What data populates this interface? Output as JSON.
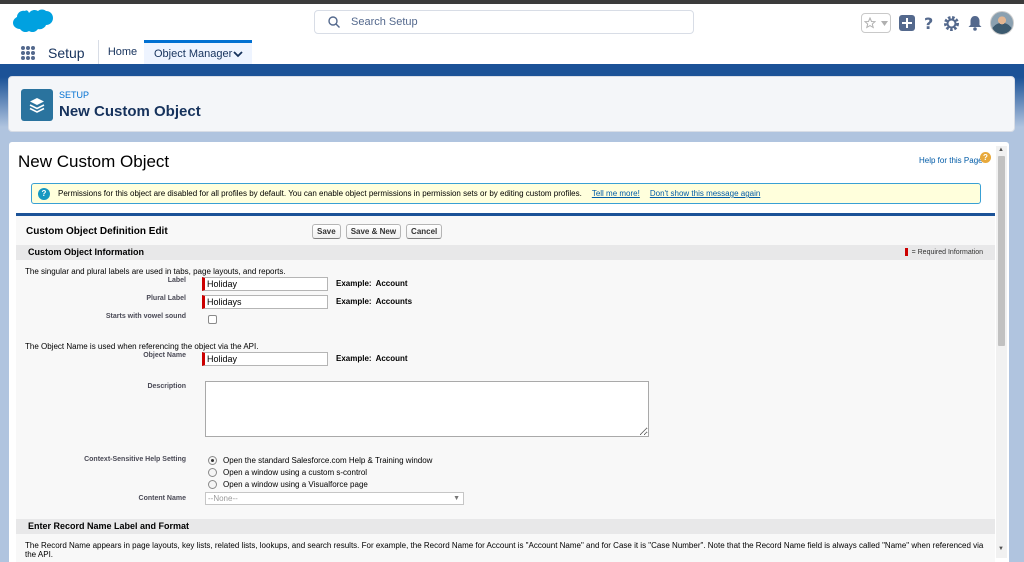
{
  "header": {
    "search_placeholder": "Search Setup",
    "icons": [
      "favorites-star-icon",
      "add-icon",
      "help-icon",
      "setup-gear-icon",
      "notifications-bell-icon",
      "user-avatar"
    ]
  },
  "nav": {
    "app_name": "Setup",
    "tabs": [
      {
        "label": "Home",
        "active": false
      },
      {
        "label": "Object Manager",
        "active": true
      }
    ]
  },
  "page_header": {
    "breadcrumb": "SETUP",
    "title": "New Custom Object"
  },
  "content": {
    "title": "New Custom Object",
    "help_link": "Help for this Page",
    "info": {
      "message": "Permissions for this object are disabled for all profiles by default. You can enable object permissions in permission sets or by editing custom profiles.",
      "tell_me_more": "Tell me more!",
      "dont_show": "Don't show this message again"
    }
  },
  "form": {
    "title": "Custom Object Definition Edit",
    "buttons": {
      "save": "Save",
      "save_new": "Save & New",
      "cancel": "Cancel"
    },
    "section1": {
      "title": "Custom Object Information",
      "required_legend": "= Required Information"
    },
    "labels_note": "The singular and plural labels are used in tabs, page layouts, and reports.",
    "label": {
      "name": "Label",
      "value": "Holiday",
      "example_key": "Example:",
      "example_value": "Account"
    },
    "plural_label": {
      "name": "Plural Label",
      "value": "Holidays",
      "example_key": "Example:",
      "example_value": "Accounts"
    },
    "vowel": {
      "name": "Starts with vowel sound",
      "checked": false
    },
    "api_note": "The Object Name is used when referencing the object via the API.",
    "object_name": {
      "name": "Object Name",
      "value": "Holiday",
      "example_key": "Example:",
      "example_value": "Account"
    },
    "description": {
      "name": "Description",
      "value": ""
    },
    "help_setting": {
      "name": "Context-Sensitive Help Setting",
      "options": [
        {
          "label": "Open the standard Salesforce.com Help & Training window",
          "selected": true
        },
        {
          "label": "Open a window using a custom s-control",
          "selected": false
        },
        {
          "label": "Open a window using a Visualforce page",
          "selected": false
        }
      ]
    },
    "content_name": {
      "name": "Content Name",
      "value": "--None--"
    },
    "section2": {
      "title": "Enter Record Name Label and Format",
      "text": "The Record Name appears in page layouts, key lists, related lists, lookups, and search results. For example, the Record Name for Account is \"Account Name\" and for Case it is \"Case Number\". Note that the Record Name field is always called \"Name\" when referenced via the API."
    }
  },
  "colors": {
    "brand_blue": "#1b5297",
    "accent": "#0070d2",
    "required": "#c00000",
    "info_bg": "#ffffdc"
  }
}
